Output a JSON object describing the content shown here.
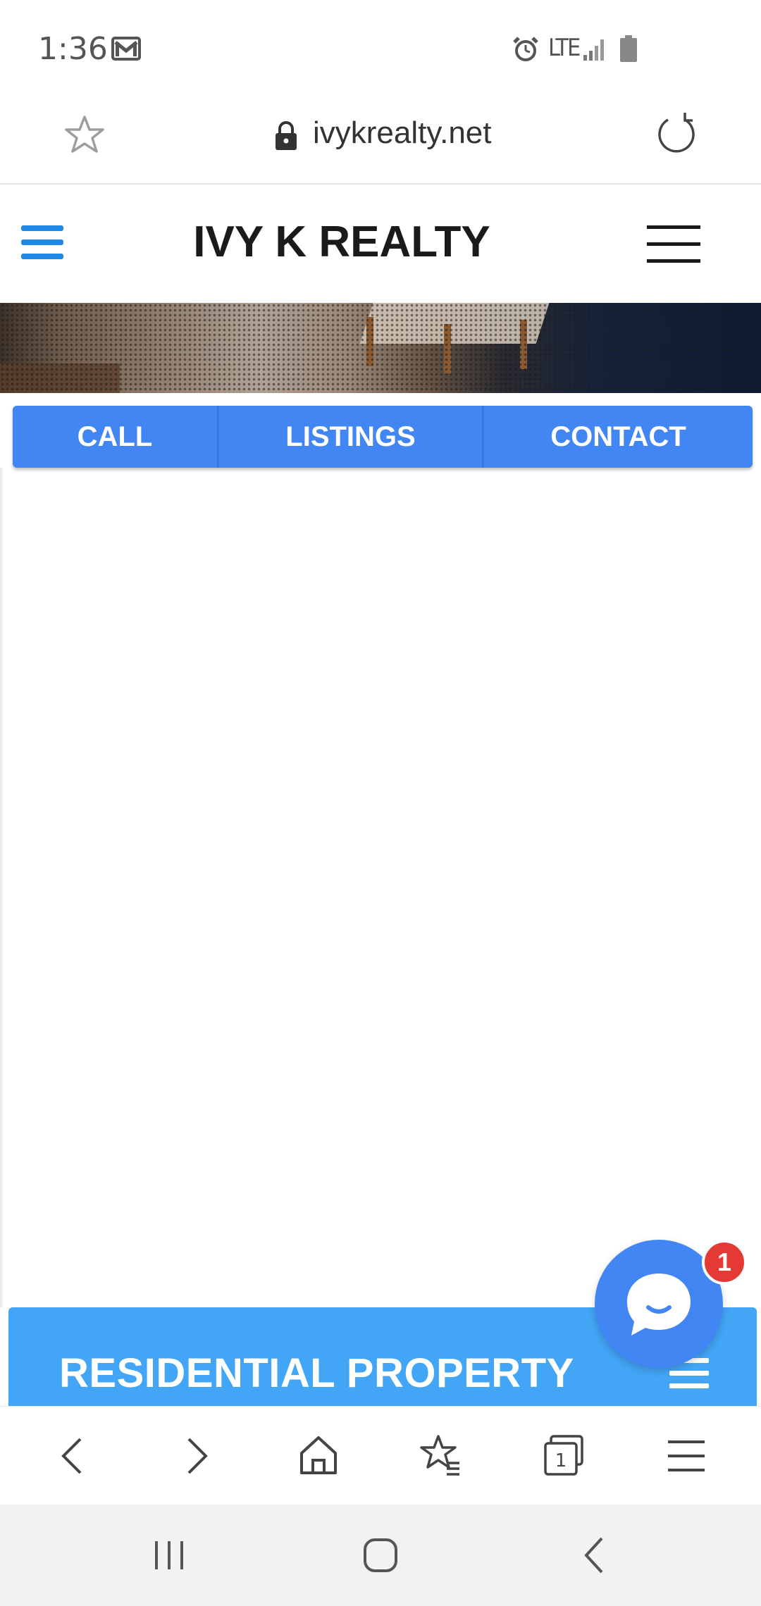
{
  "status_bar": {
    "time": "1:36",
    "network": "LTE",
    "icons": [
      "gmail-icon",
      "alarm-icon",
      "signal-icon",
      "battery-icon"
    ]
  },
  "address_bar": {
    "url": "ivykrealty.net",
    "icons": [
      "star-icon",
      "lock-icon",
      "reload-icon"
    ]
  },
  "site_header": {
    "title": "IVY K REALTY",
    "icons": [
      "menu-icon",
      "hamburger-menu-icon"
    ]
  },
  "nav": {
    "call_label": "CALL",
    "listings_label": "LISTINGS",
    "contact_label": "CONTACT",
    "color": "#4286f4"
  },
  "residential_banner": {
    "title": "RESIDENTIAL PROPERTY",
    "color": "#42a5f5"
  },
  "chat_widget": {
    "badge_count": "1",
    "badge_color": "#e53935"
  },
  "browser_toolbar": {
    "items": [
      "back-icon",
      "forward-icon",
      "home-icon",
      "bookmarks-icon",
      "tabs-icon",
      "menu-icon"
    ],
    "tab_count": "1"
  },
  "system_nav": {
    "items": [
      "recent-apps-icon",
      "home-button-icon",
      "back-icon"
    ]
  }
}
